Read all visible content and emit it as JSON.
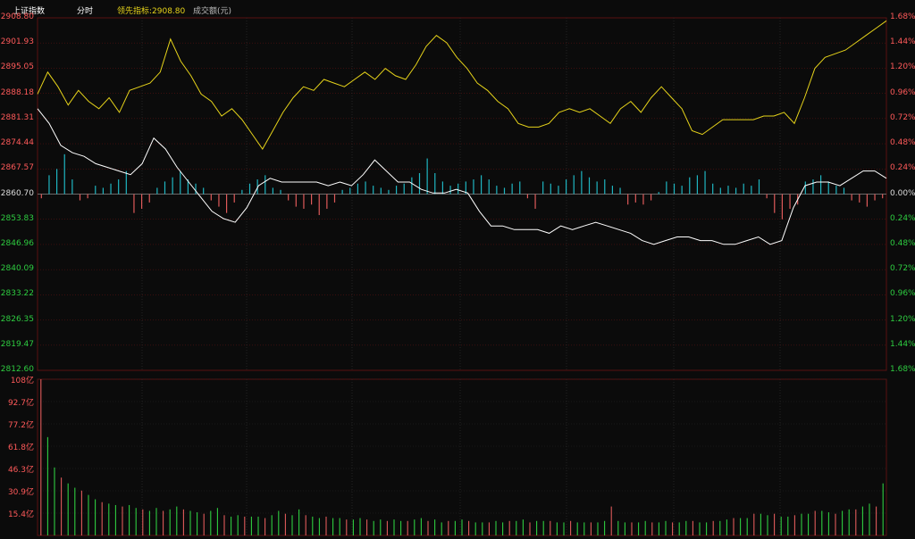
{
  "header": {
    "index_name": "上证指数",
    "mode": "分时",
    "leading_label": "领先指标:2908.80",
    "volume_label": "成交额(元)"
  },
  "colors": {
    "up": "#e05a5a",
    "down": "#1fb6c2",
    "leading_line": "#e6d31a",
    "index_line": "#ffffff",
    "axis_pos": "#ff5a5a",
    "axis_neg": "#2ecc40",
    "grid": "#5a1010"
  },
  "chart_data": [
    {
      "type": "line",
      "name": "intraday-price",
      "baseline": 2860.7,
      "ylim": [
        2812.6,
        2908.8
      ],
      "left_ticks": [
        "2908.80",
        "2901.93",
        "2895.05",
        "2888.18",
        "2881.31",
        "2874.44",
        "2867.57",
        "2860.70",
        "2853.83",
        "2846.96",
        "2840.09",
        "2833.22",
        "2826.35",
        "2819.47",
        "2812.60"
      ],
      "right_ticks": [
        "1.68%",
        "1.44%",
        "1.20%",
        "0.96%",
        "0.72%",
        "0.48%",
        "0.24%",
        "0.00%",
        "0.24%",
        "0.48%",
        "0.72%",
        "0.96%",
        "1.20%",
        "1.44%",
        "1.68%"
      ],
      "series": [
        {
          "name": "领先指标",
          "values": [
            2888,
            2894,
            2890,
            2885,
            2889,
            2886,
            2884,
            2887,
            2883,
            2889,
            2890,
            2891,
            2894,
            2903,
            2897,
            2893,
            2888,
            2886,
            2882,
            2884,
            2881,
            2877,
            2873,
            2878,
            2883,
            2887,
            2890,
            2889,
            2892,
            2891,
            2890,
            2892,
            2894,
            2892,
            2895,
            2893,
            2892,
            2896,
            2901,
            2904,
            2902,
            2898,
            2895,
            2891,
            2889,
            2886,
            2884,
            2880,
            2879,
            2879,
            2880,
            2883,
            2884,
            2883,
            2884,
            2882,
            2880,
            2884,
            2886,
            2883,
            2887,
            2890,
            2887,
            2884,
            2878,
            2877,
            2879,
            2881,
            2881,
            2881,
            2881,
            2882,
            2882,
            2883,
            2880,
            2887,
            2895,
            2898,
            2899,
            2900,
            2902,
            2904,
            2906,
            2908
          ]
        },
        {
          "name": "上证指数",
          "values": [
            2884,
            2880,
            2874,
            2872,
            2871,
            2869,
            2868,
            2867,
            2866,
            2869,
            2876,
            2873,
            2868,
            2864,
            2860,
            2856,
            2854,
            2853,
            2857,
            2863,
            2865,
            2864,
            2864,
            2864,
            2864,
            2863,
            2864,
            2863,
            2866,
            2870,
            2867,
            2864,
            2864,
            2862,
            2861,
            2861,
            2862,
            2861,
            2856,
            2852,
            2852,
            2851,
            2851,
            2851,
            2850,
            2852,
            2851,
            2852,
            2853,
            2852,
            2851,
            2850,
            2848,
            2847,
            2848,
            2849,
            2849,
            2848,
            2848,
            2847,
            2847,
            2848,
            2849,
            2847,
            2848,
            2857,
            2863,
            2864,
            2864,
            2863,
            2865,
            2867,
            2867,
            2865
          ]
        }
      ]
    },
    {
      "type": "bar",
      "name": "breadth-bars",
      "unit": "0.01% of baseline",
      "values": [
        4,
        -18,
        -24,
        -38,
        -14,
        6,
        4,
        -8,
        -6,
        -10,
        -14,
        -22,
        18,
        14,
        8,
        -6,
        -12,
        -16,
        -22,
        -14,
        -10,
        -6,
        6,
        12,
        18,
        8,
        -4,
        -10,
        -14,
        -18,
        -6,
        -4,
        6,
        12,
        14,
        10,
        20,
        14,
        8,
        -4,
        -6,
        -10,
        -12,
        -8,
        -6,
        -4,
        -8,
        -10,
        -16,
        -20,
        -34,
        -20,
        -12,
        -8,
        -10,
        -12,
        -14,
        -18,
        -14,
        -8,
        -6,
        -10,
        -12,
        4,
        14,
        -12,
        -10,
        -8,
        -14,
        -18,
        -22,
        -16,
        -12,
        -14,
        -8,
        -6,
        10,
        8,
        10,
        6,
        -2,
        -12,
        -10,
        -8,
        -16,
        -18,
        -22,
        -10,
        -6,
        -8,
        -6,
        -10,
        -8,
        -14,
        4,
        18,
        24,
        14,
        10,
        -12,
        -14,
        -18,
        -12,
        -8,
        -6,
        6,
        8,
        12,
        6,
        4
      ]
    },
    {
      "type": "bar",
      "name": "turnover",
      "ylabel": "成交额(元)",
      "ylim": [
        0,
        108
      ],
      "ticks": [
        "108亿",
        "92.7亿",
        "77.2亿",
        "61.8亿",
        "46.3亿",
        "30.9亿",
        "15.4亿"
      ],
      "values": [
        108,
        68,
        47,
        40,
        36,
        33,
        31,
        28,
        25,
        23,
        22,
        21,
        20,
        21,
        19,
        18,
        17,
        19,
        17,
        18,
        20,
        18,
        17,
        16,
        15,
        17,
        19,
        14,
        13,
        14,
        13,
        13,
        13,
        12,
        14,
        17,
        15,
        14,
        18,
        14,
        13,
        12,
        13,
        12,
        12,
        11,
        11,
        12,
        11,
        10,
        11,
        10,
        11,
        10,
        10,
        11,
        12,
        10,
        11,
        9,
        10,
        10,
        11,
        10,
        9,
        9,
        9,
        10,
        9,
        10,
        10,
        11,
        9,
        10,
        10,
        10,
        9,
        9,
        10,
        9,
        9,
        9,
        9,
        10,
        20,
        10,
        9,
        9,
        9,
        10,
        9,
        9,
        10,
        9,
        9,
        10,
        10,
        9,
        9,
        10,
        10,
        11,
        12,
        12,
        12,
        15,
        15,
        14,
        15,
        13,
        13,
        14,
        15,
        15,
        17,
        17,
        16,
        15,
        17,
        18,
        18,
        20,
        22,
        20,
        36
      ]
    }
  ]
}
